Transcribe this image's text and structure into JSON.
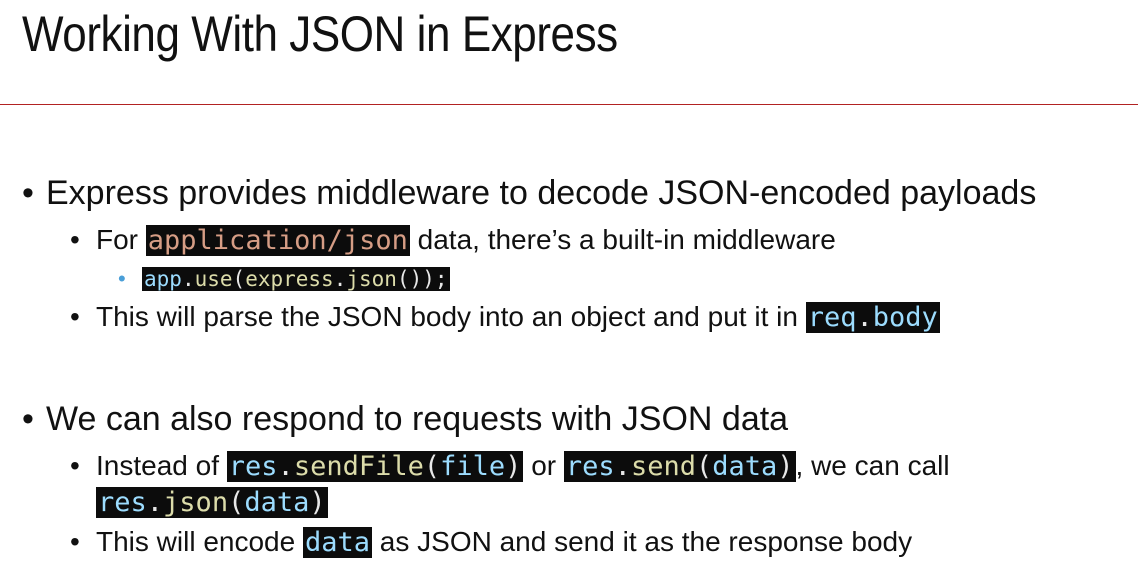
{
  "title": "Working With JSON in Express",
  "colors": {
    "rule": "#b22222",
    "code_bg": "#0c0c0c",
    "string": "#d69d85",
    "variable": "#9cdcfe",
    "function": "#dcdcaa",
    "sub_bullet": "#4a9fd8"
  },
  "bullets": {
    "b1": {
      "text": "Express provides middleware to decode JSON-encoded payloads"
    },
    "b1_1": {
      "before": "For ",
      "code": "application/json",
      "after": " data, there’s a built-in middleware"
    },
    "b1_1_1": {
      "c1": "app",
      "c2": ".",
      "c3": "use",
      "c4": "(",
      "c5": "express",
      "c6": ".",
      "c7": "json",
      "c8": "());"
    },
    "b1_2": {
      "before": "This will parse the JSON body into an object and put it in ",
      "c1": "req",
      "c2": ".",
      "c3": "body"
    },
    "b2": {
      "text": "We can also respond to requests with JSON data"
    },
    "b2_1": {
      "before": "Instead of ",
      "code1": {
        "c1": "res",
        "c2": ".",
        "c3": "sendFile",
        "c4": "(",
        "c5": "file",
        "c6": ")"
      },
      "middle": " or ",
      "code2": {
        "c1": "res",
        "c2": ".",
        "c3": "send",
        "c4": "(",
        "c5": "data",
        "c6": ")"
      },
      "after": ", we can call",
      "code3": {
        "c1": "res",
        "c2": ".",
        "c3": "json",
        "c4": "(",
        "c5": "data",
        "c6": ")"
      }
    },
    "b2_2": {
      "before": "This will encode ",
      "code": "data",
      "after": " as JSON and send it as the response body"
    }
  }
}
